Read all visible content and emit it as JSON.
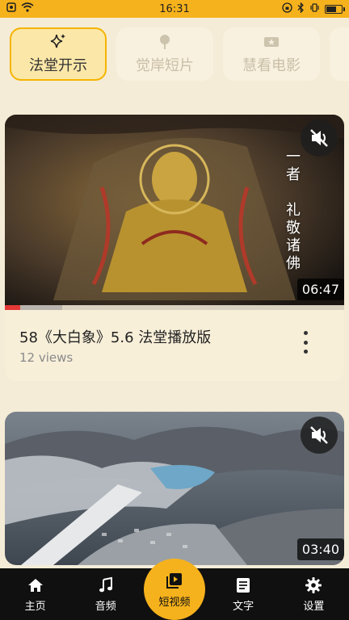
{
  "status_bar": {
    "time": "16:31"
  },
  "tabs": [
    {
      "label": "法堂开示",
      "icon": "sparkles-icon",
      "active": true
    },
    {
      "label": "觉岸短片",
      "icon": "tree-icon",
      "active": false
    },
    {
      "label": "慧看电影",
      "icon": "film-ticket-icon",
      "active": false
    }
  ],
  "videos": [
    {
      "title": "58《大白象》5.6 法堂播放版",
      "views": "12 views",
      "duration": "06:47",
      "overlay_text": "一者　礼敬诸佛",
      "progress_fraction": 0.045,
      "buffered_fraction": 0.17
    },
    {
      "duration": "03:40"
    }
  ],
  "bottom_nav": [
    {
      "label": "主页",
      "icon": "home-icon",
      "active": false
    },
    {
      "label": "音频",
      "icon": "music-note-icon",
      "active": false
    },
    {
      "label": "短视频",
      "icon": "video-playlist-icon",
      "active": true
    },
    {
      "label": "文字",
      "icon": "document-icon",
      "active": false
    },
    {
      "label": "设置",
      "icon": "gear-icon",
      "active": false
    }
  ],
  "colors": {
    "accent": "#f6b21c",
    "background": "#f5ecd7",
    "progress_played": "#e53935"
  }
}
